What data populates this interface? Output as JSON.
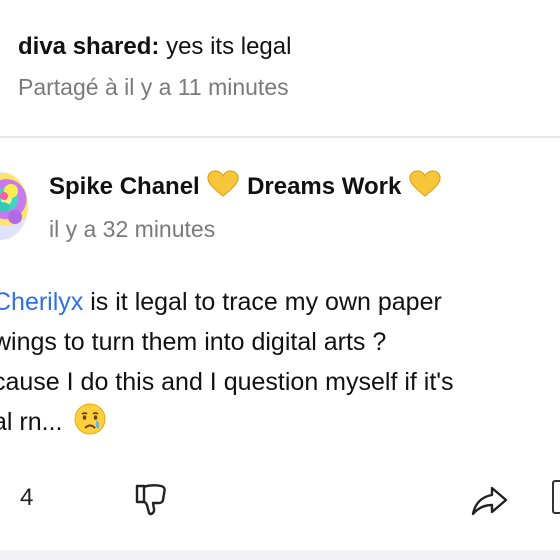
{
  "shared_notice": {
    "user": "diva shared:",
    "message": "yes its legal",
    "time": "Partagé à il y a 11 minutes"
  },
  "post": {
    "author_name": "Spike Chanel",
    "author_suffix": "Dreams Work",
    "time": "il y a 32 minutes",
    "mention": "Cherilyx",
    "body_line1_rest": " is it legal to trace my own  paper",
    "body_line2": "wings to turn them into digital arts ?",
    "body_line3": "cause I do this and I question myself if it's",
    "body_line4": "al rn... ",
    "colors": {
      "mention": "#2f6fe8",
      "muted": "#7a7a7a"
    }
  },
  "actions": {
    "like_count": "4",
    "dislike_icon": "thumbs-down-icon",
    "share_icon": "share-arrow-icon"
  }
}
